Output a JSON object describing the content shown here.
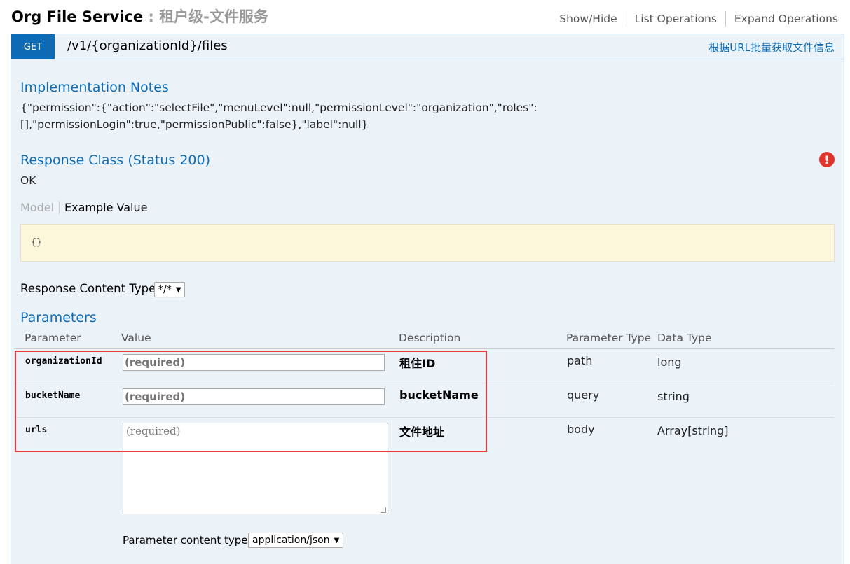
{
  "header": {
    "service_name": "Org File Service",
    "separator": " : ",
    "service_subtitle": "租户级-文件服务",
    "links": [
      "Show/Hide",
      "List Operations",
      "Expand Operations"
    ]
  },
  "operation": {
    "method": "GET",
    "path": "/v1/{organizationId}/files",
    "summary": "根据URL批量获取文件信息"
  },
  "implementation_notes": {
    "title": "Implementation Notes",
    "line1": "{\"permission\":{\"action\":\"selectFile\",\"menuLevel\":null,\"permissionLevel\":\"organization\",\"roles\":",
    "line2": "[],\"permissionLogin\":true,\"permissionPublic\":false},\"label\":null}"
  },
  "response_class": {
    "title": "Response Class (Status 200)",
    "status_text": "OK",
    "tab_model": "Model",
    "tab_example": "Example Value",
    "example_value": "{}",
    "alert_glyph": "!"
  },
  "response_content_type": {
    "label": "Response Content Type",
    "selected": "*/*"
  },
  "parameters": {
    "title": "Parameters",
    "columns": [
      "Parameter",
      "Value",
      "Description",
      "Parameter Type",
      "Data Type"
    ],
    "rows": [
      {
        "name": "organizationId",
        "placeholder": "(required)",
        "description": "租住ID",
        "param_type": "path",
        "data_type": "long"
      },
      {
        "name": "bucketName",
        "placeholder": "(required)",
        "description": "bucketName",
        "param_type": "query",
        "data_type": "string"
      },
      {
        "name": "urls",
        "placeholder": "(required)",
        "description": "文件地址",
        "param_type": "body",
        "data_type": "Array[string]"
      }
    ],
    "content_type_label": "Parameter content type:",
    "content_type_selected": "application/json"
  },
  "colors": {
    "accent": "#0f6ab4",
    "highlight_border": "#e83a3a",
    "panel_bg": "#ebf3f9",
    "example_bg": "#fcf6db",
    "alert": "#e0332b"
  }
}
